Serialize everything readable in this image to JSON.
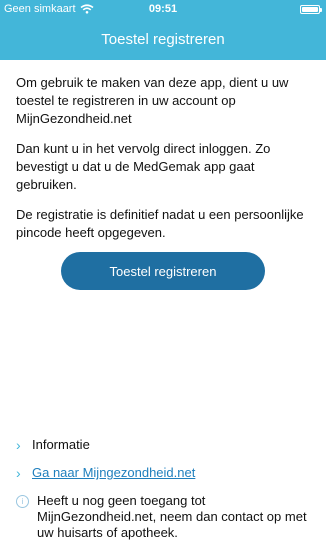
{
  "status_bar": {
    "carrier": "Geen simkaart",
    "time": "09:51",
    "icons": [
      "wifi-icon",
      "battery-icon"
    ]
  },
  "header": {
    "title": "Toestel registreren"
  },
  "main": {
    "paragraphs": [
      "Om gebruik te maken van deze app, dient u uw toestel te registreren in uw account op MijnGezondheid.net",
      "Dan kunt u in het vervolg direct inloggen. Zo bevestigt u dat u de MedGemak app gaat gebruiken.",
      "De registratie is definitief nadat u een persoonlijke pincode heeft opgegeven."
    ],
    "button_label": "Toestel registreren"
  },
  "footer": {
    "items": [
      {
        "label": "Informatie",
        "icon": "chevron-right-icon"
      },
      {
        "label": "Ga naar Mijngezondheid.net",
        "icon": "chevron-right-icon"
      }
    ],
    "info_text": "Heeft u nog geen toegang tot MijnGezondheid.net, neem dan contact op met uw huisarts of apotheek.",
    "info_icon": "i"
  },
  "colors": {
    "header": "#43b6d9",
    "button": "#1f6fa2",
    "link": "#1f7fbd"
  }
}
